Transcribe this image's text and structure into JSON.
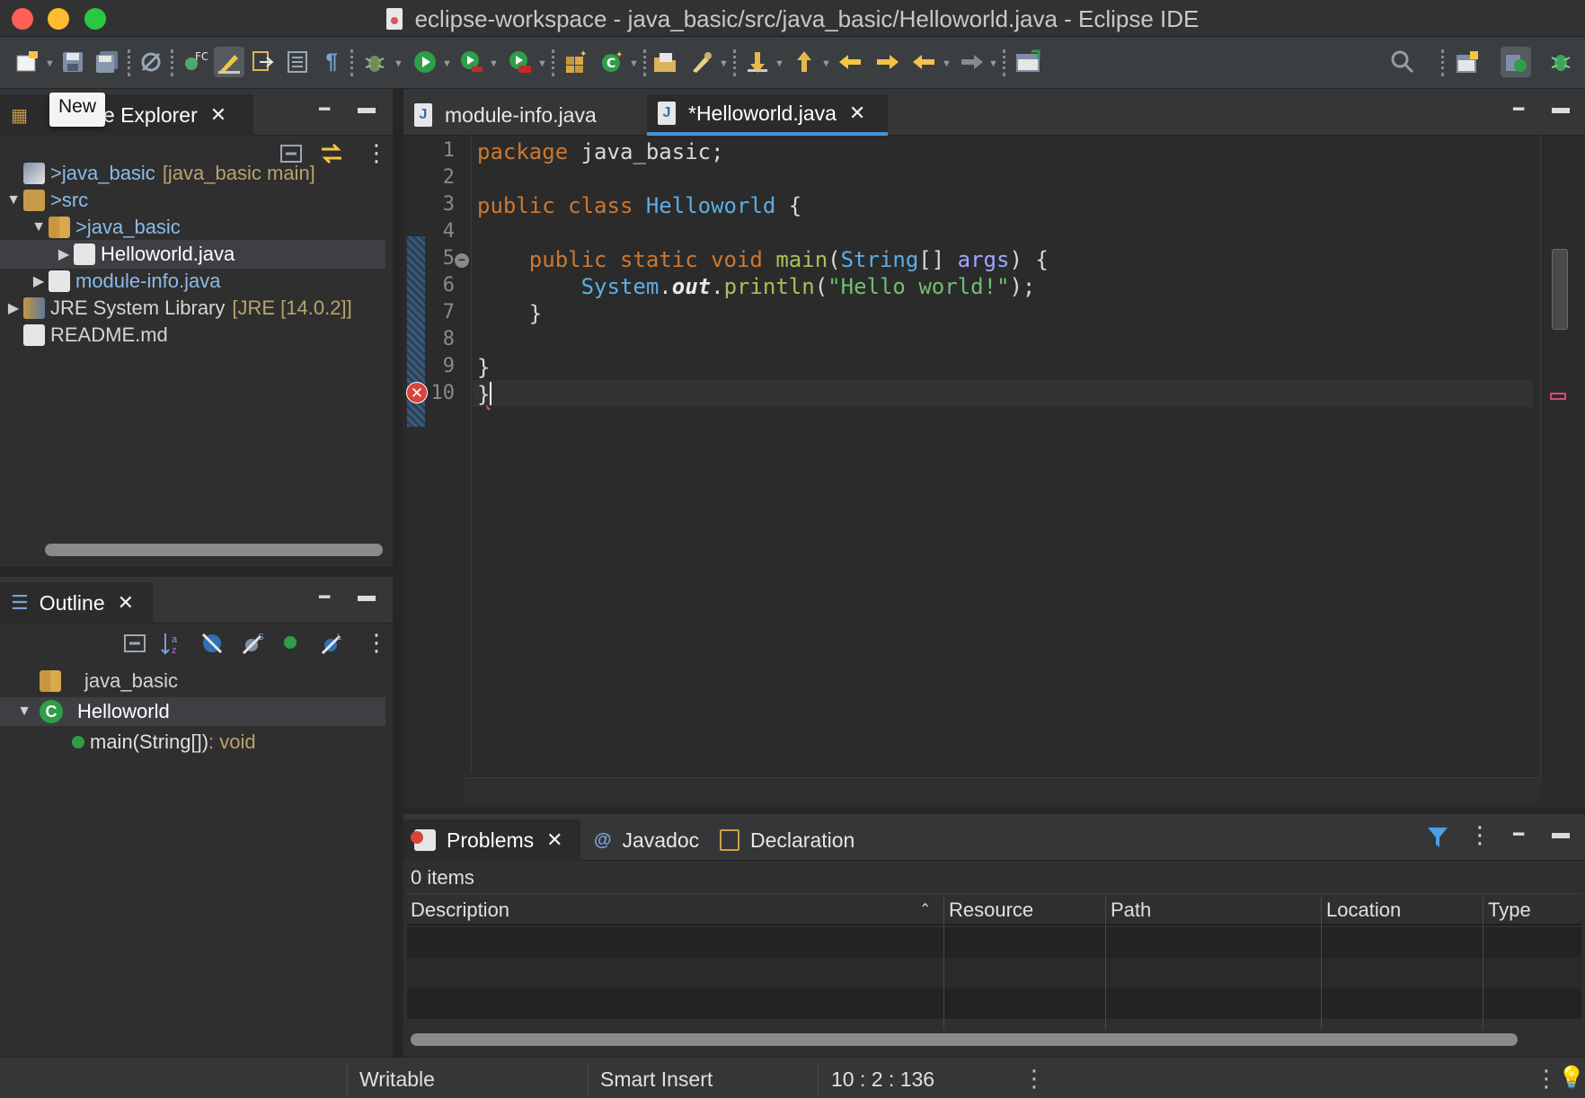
{
  "window": {
    "title": "eclipse-workspace - java_basic/src/java_basic/Helloworld.java - Eclipse IDE"
  },
  "toolbar_icons": [
    "new-icon",
    "save-icon",
    "save-all-icon",
    "skip-breakpoints-icon",
    "open-type-icon",
    "toggle-mark-occurrences-icon",
    "toggle-block-selection-icon",
    "toggle-word-wrap-icon",
    "show-whitespace-icon",
    "debug-icon",
    "run-icon",
    "run-coverage-icon",
    "external-tools-icon",
    "new-java-package-icon",
    "new-java-class-icon",
    "open-folder-icon",
    "search-pen-icon",
    "next-annotation-icon",
    "previous-annotation-icon",
    "last-edit-icon",
    "forward-history-icon",
    "back-icon",
    "forward-icon",
    "open-console-icon",
    "search-icon",
    "open-perspective-icon",
    "java-perspective-icon",
    "debug-perspective-icon"
  ],
  "tooltip": {
    "text": "New"
  },
  "package_explorer": {
    "tab_label": "Package Explorer",
    "tab_label_visible": "e Explorer",
    "tree": [
      {
        "label": "java_basic",
        "prefix": "> ",
        "suffix": "[java_basic main]",
        "indent": 0,
        "twisty": ""
      },
      {
        "label": "src",
        "prefix": "> ",
        "suffix": "",
        "indent": 0,
        "twisty": "▼"
      },
      {
        "label": "java_basic",
        "prefix": "> ",
        "suffix": "",
        "indent": 1,
        "twisty": "▼"
      },
      {
        "label": "Helloworld.java",
        "prefix": "",
        "suffix": "",
        "indent": 2,
        "twisty": "▶"
      },
      {
        "label": "module-info.java",
        "prefix": "",
        "suffix": "",
        "indent": 1,
        "twisty": "▶"
      },
      {
        "label": "JRE System Library",
        "prefix": "",
        "suffix": "[JRE [14.0.2]]",
        "indent": 0,
        "twisty": "▶"
      },
      {
        "label": "README.md",
        "prefix": "",
        "suffix": "",
        "indent": 0,
        "twisty": ""
      }
    ]
  },
  "outline": {
    "tab_label": "Outline",
    "tree": [
      {
        "label": "java_basic",
        "suffix": ""
      },
      {
        "label": "Helloworld",
        "suffix": ""
      },
      {
        "label": "main(String[])",
        "suffix": " : void"
      }
    ]
  },
  "editor": {
    "tabs": [
      {
        "label": "module-info.java",
        "active": false
      },
      {
        "label": "*Helloworld.java",
        "active": true
      }
    ],
    "line_numbers": [
      "1",
      "2",
      "3",
      "4",
      "5",
      "6",
      "7",
      "8",
      "9",
      "10"
    ],
    "code": {
      "l1_kw": "package",
      "l1_rest": " java_basic;",
      "l3_kw": "public class",
      "l3_cls": "Helloworld",
      "l3_rest": " {",
      "l5_kw": "public static void",
      "l5_fn": "main",
      "l5_p1": "(",
      "l5_type": "String",
      "l5_p2": "[] ",
      "l5_arg": "args",
      "l5_rest": ") {",
      "l6_cls": "System",
      "l6_dot": ".",
      "l6_field": "out",
      "l6_dot2": ".",
      "l6_fn": "println",
      "l6_p1": "(",
      "l6_str": "\"Hello world!\"",
      "l6_rest": ");",
      "l7": "}",
      "l9": "}",
      "l10": "}"
    },
    "cursor": {
      "line": 10,
      "column": 2
    }
  },
  "bottom_panel": {
    "tabs": [
      {
        "label": "Problems",
        "active": true
      },
      {
        "label": "Javadoc",
        "active": false
      },
      {
        "label": "Declaration",
        "active": false
      }
    ],
    "summary": "0 items",
    "columns": [
      "Description",
      "Resource",
      "Path",
      "Location",
      "Type"
    ]
  },
  "status_bar": {
    "writable": "Writable",
    "insert_mode": "Smart Insert",
    "position": "10 : 2 : 136"
  }
}
